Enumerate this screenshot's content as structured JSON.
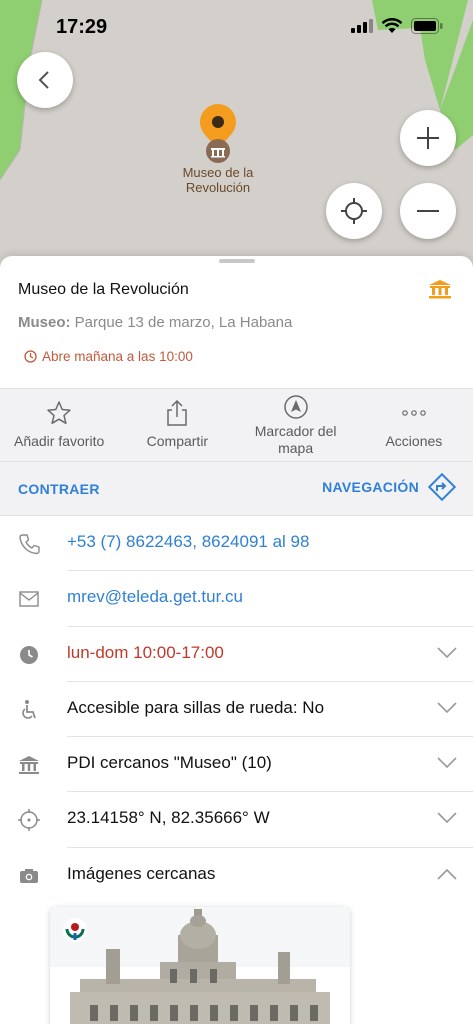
{
  "status_bar": {
    "time": "17:29"
  },
  "map": {
    "poi_label": "Museo de la Revolución",
    "colors": {
      "park": "#8fce71",
      "building": "#d3cfca",
      "pin": "#f39c1e"
    }
  },
  "place": {
    "title": "Museo de la Revolución",
    "category": "Museo:",
    "address": "Parque 13 de marzo, La Habana",
    "open_status": "Abre mañana a las 10:00",
    "category_icon": "museum-icon"
  },
  "actions": [
    {
      "label": "Añadir favorito",
      "icon": "star-icon"
    },
    {
      "label": "Compartir",
      "icon": "share-icon"
    },
    {
      "label": "Marcador del mapa",
      "icon": "map-marker-icon"
    },
    {
      "label": "Acciones",
      "icon": "more-icon"
    }
  ],
  "nav": {
    "collapse": "CONTRAER",
    "navigate": "NAVEGACIÓN"
  },
  "info": {
    "phone": "+53 (7) 8622463, 8624091 al 98",
    "email": "mrev@teleda.get.tur.cu",
    "hours": "lun-dom 10:00-17:00",
    "wheelchair": "Accesible para sillas de rueda: No",
    "nearby_poi": "PDI cercanos \"Museo\" (10)",
    "coordinates": "23.14158° N, 82.35666° W",
    "nearby_images": "Imágenes cercanas"
  },
  "theme": {
    "accent": "#2f80d6",
    "warning": "#c15a3c",
    "closed": "#c0392b",
    "category": "#f39c1e"
  }
}
